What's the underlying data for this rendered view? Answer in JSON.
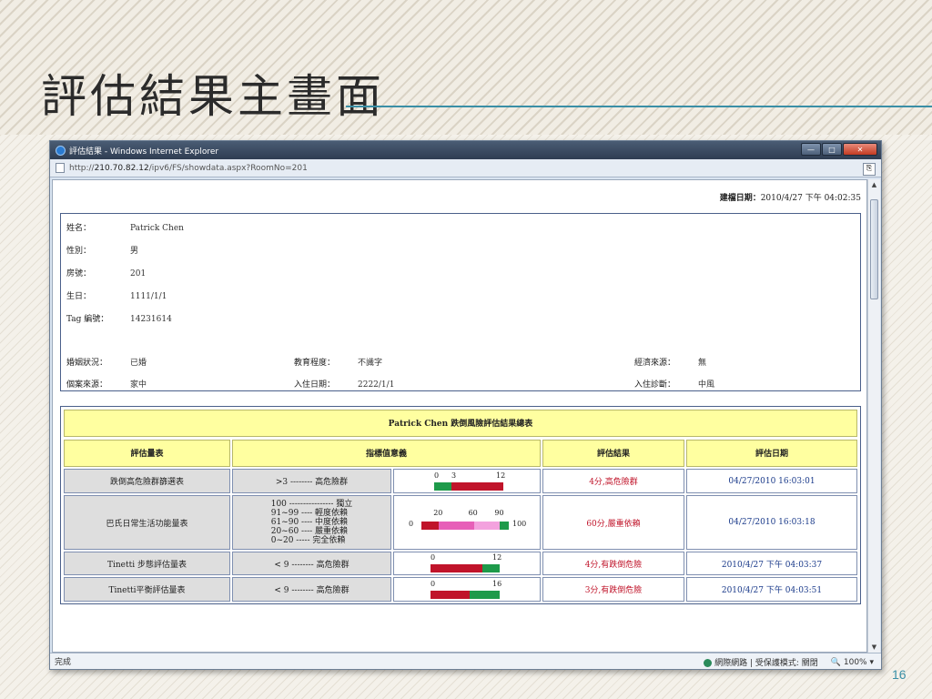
{
  "slide": {
    "title": "評估結果主畫面",
    "page_number": "16"
  },
  "window": {
    "title": "評估結果 - Windows Internet Explorer",
    "url_prefix": "http://",
    "url_host": "210.70.82.12",
    "url_path": "/ipv6/FS/showdata.aspx?RoomNo=201",
    "status_left": "完成",
    "status_zone": "網際網路 | 受保護模式: 關閉",
    "zoom": "100%"
  },
  "build": {
    "label": "建檔日期：",
    "value": "2010/4/27 下午 04:02:35"
  },
  "patient": {
    "fields": [
      {
        "label": "姓名：",
        "value": "Patrick Chen"
      },
      {
        "label": "性別：",
        "value": "男"
      },
      {
        "label": "房號：",
        "value": "201"
      },
      {
        "label": "生日：",
        "value": "1111/1/1"
      },
      {
        "label": "Tag 編號：",
        "value": "14231614"
      }
    ],
    "row1": [
      {
        "label": "婚姻狀況：",
        "value": "已婚"
      },
      {
        "label": "教育程度：",
        "value": "不識字"
      },
      {
        "label": "經濟來源：",
        "value": "無"
      }
    ],
    "row2": [
      {
        "label": "個案來源：",
        "value": "家中"
      },
      {
        "label": "入住日期：",
        "value": "2222/1/1"
      },
      {
        "label": "入住診斷：",
        "value": "中風"
      }
    ]
  },
  "results": {
    "title": "Patrick Chen 跌倒風險評估結果總表",
    "headers": [
      "評估量表",
      "指標值意義",
      "評估結果",
      "評估日期"
    ],
    "rows": [
      {
        "scale": "跌倒高危險群篩選表",
        "meaning": ">3 -------- 高危險群",
        "scale_ticks": [
          "0",
          "3",
          "12"
        ],
        "score": 4,
        "max": 12,
        "result": "4分,高危險群",
        "date": "04/27/2010 16:03:01"
      },
      {
        "scale": "巴氏日常生活功能量表",
        "meaning_lines": [
          "100 ---------------- 獨立",
          "91~99 ---- 輕度依賴",
          "61~90 ---- 中度依賴",
          "20~60 ---- 嚴重依賴",
          "0~20 ----- 完全依賴"
        ],
        "scale_ticks": [
          "0",
          "20",
          "60",
          "90",
          "100"
        ],
        "score": 60,
        "max": 100,
        "result": "60分,嚴重依賴",
        "date": "04/27/2010 16:03:18"
      },
      {
        "scale": "Tinetti 步態評估量表",
        "meaning": "< 9 -------- 高危險群",
        "scale_ticks": [
          "0",
          "12"
        ],
        "score": 4,
        "max": 12,
        "result": "4分,有跌倒危險",
        "date": "2010/4/27 下午 04:03:37"
      },
      {
        "scale": "Tinetti平衡評估量表",
        "meaning": "< 9 -------- 高危險群",
        "scale_ticks": [
          "0",
          "16"
        ],
        "score": 3,
        "max": 16,
        "result": "3分,有跌倒危險",
        "date": "2010/4/27 下午 04:03:51"
      }
    ]
  },
  "colors": {
    "header_bg": "#ffffa0",
    "danger": "#c0142a",
    "ok": "#1e9a4a",
    "pink": "#e75fb8",
    "light_pink": "#f3a2de"
  }
}
